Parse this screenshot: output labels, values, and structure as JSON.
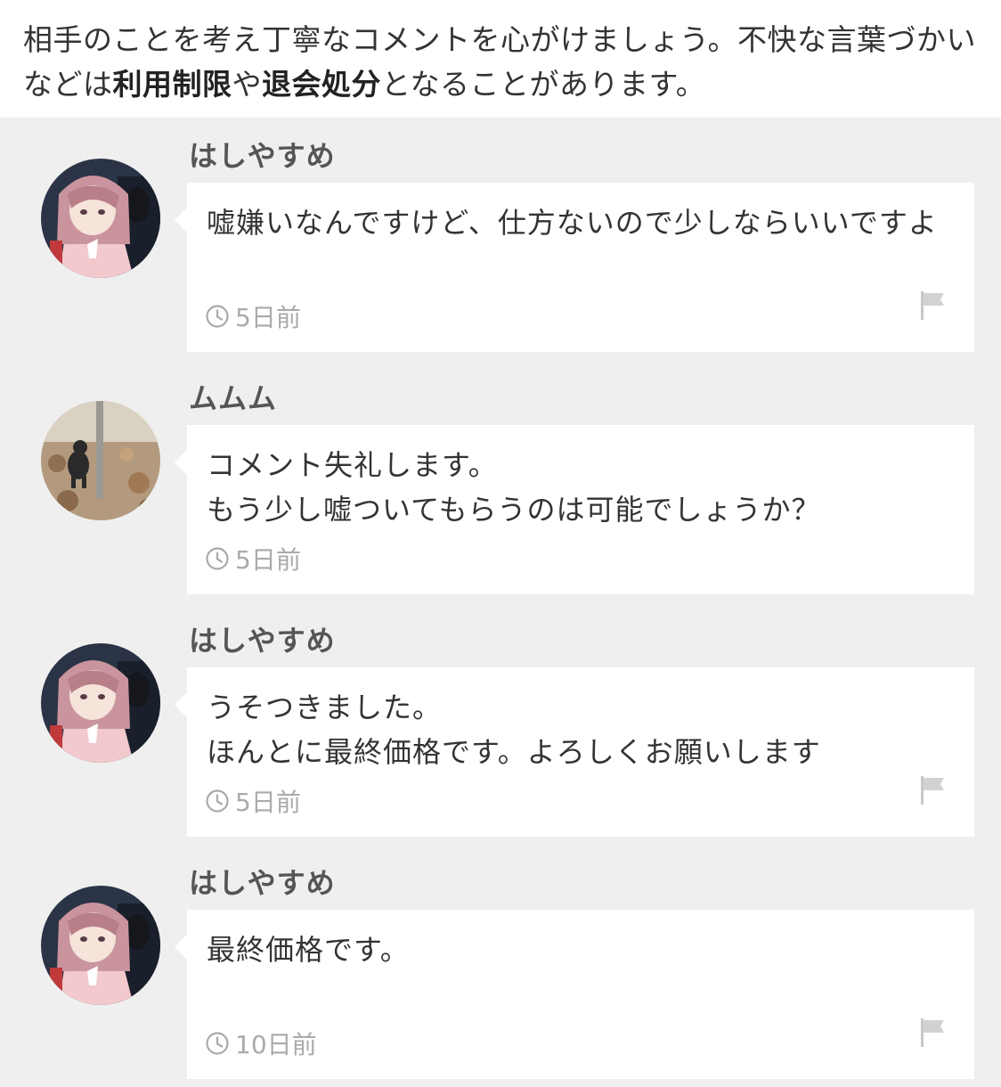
{
  "notice": {
    "part1": "相手のことを考え丁寧なコメントを心がけましょう。不快な言葉づかいなどは",
    "bold1": "利用制限",
    "part2": "や",
    "bold2": "退会処分",
    "part3": "となることがあります。"
  },
  "comments": [
    {
      "username": "はしやすめ",
      "text": "嘘嫌いなんですけど、仕方ないので少しならいいですよ",
      "time": "5日前",
      "avatar": "anime-girl-avatar",
      "flag": true
    },
    {
      "username": "ムムム",
      "text": "コメント失礼します。\nもう少し嘘ついてもらうのは可能でしょうか？",
      "time": "5日前",
      "avatar": "dog-photo-avatar",
      "flag": false
    },
    {
      "username": "はしやすめ",
      "text": "うそつきました。\nほんとに最終価格です。よろしくお願いします",
      "time": "5日前",
      "avatar": "anime-girl-avatar",
      "flag": true
    },
    {
      "username": "はしやすめ",
      "text": "最終価格です。",
      "time": "10日前",
      "avatar": "anime-girl-avatar",
      "flag": true
    }
  ],
  "colors": {
    "background": "#efefef",
    "bubble": "#ffffff",
    "meta": "#aaaaaa"
  }
}
